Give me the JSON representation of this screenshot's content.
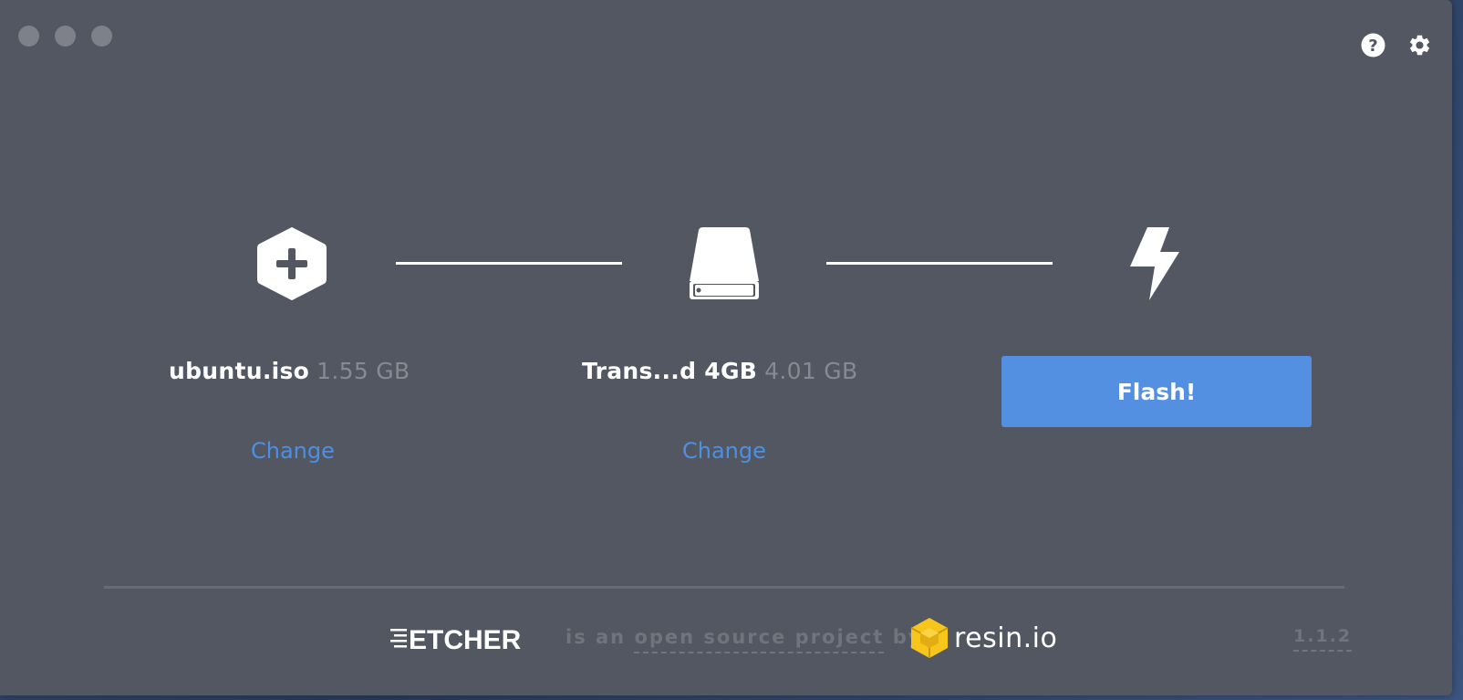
{
  "window": {
    "controls": [
      "close",
      "minimize",
      "maximize"
    ],
    "top_icons": [
      "help-icon",
      "settings-icon"
    ]
  },
  "steps": {
    "image": {
      "icon": "add-image-icon",
      "name": "ubuntu.iso",
      "size": "1.55 GB",
      "change_label": "Change"
    },
    "drive": {
      "icon": "drive-icon",
      "name": "Trans...d 4GB",
      "size": "4.01 GB",
      "change_label": "Change"
    },
    "flash": {
      "icon": "lightning-icon",
      "button_label": "Flash!"
    }
  },
  "footer": {
    "brand": "ETCHER",
    "text": "is an open source project by",
    "link_text": "open source project",
    "company": "resin.io",
    "version": "1.1.2"
  },
  "colors": {
    "window_bg": "#535762",
    "accent": "#5390e1",
    "link": "#4d90e2",
    "muted": "#868a92",
    "resin_yellow": "#f6c61b"
  }
}
